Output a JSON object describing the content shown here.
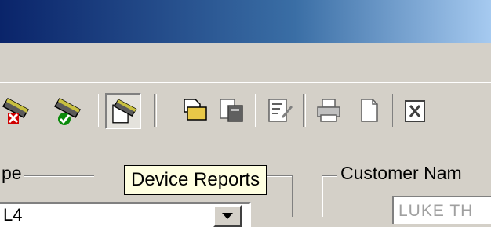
{
  "toolbar": {
    "buttons": [
      {
        "name": "device-red-x-icon"
      },
      {
        "name": "device-green-check-icon"
      },
      {
        "name": "device-reports-icon",
        "pressed": true
      },
      {
        "name": "open-folder-icon"
      },
      {
        "name": "paste-icon"
      },
      {
        "name": "edit-document-icon"
      },
      {
        "name": "print-icon"
      },
      {
        "name": "new-document-icon"
      },
      {
        "name": "export-icon"
      }
    ]
  },
  "tooltip": {
    "text": "Device Reports"
  },
  "left_group": {
    "label": "pe",
    "combo_value": "L4"
  },
  "customer_group": {
    "label": "Customer Nam",
    "value": "LUKE TH"
  }
}
